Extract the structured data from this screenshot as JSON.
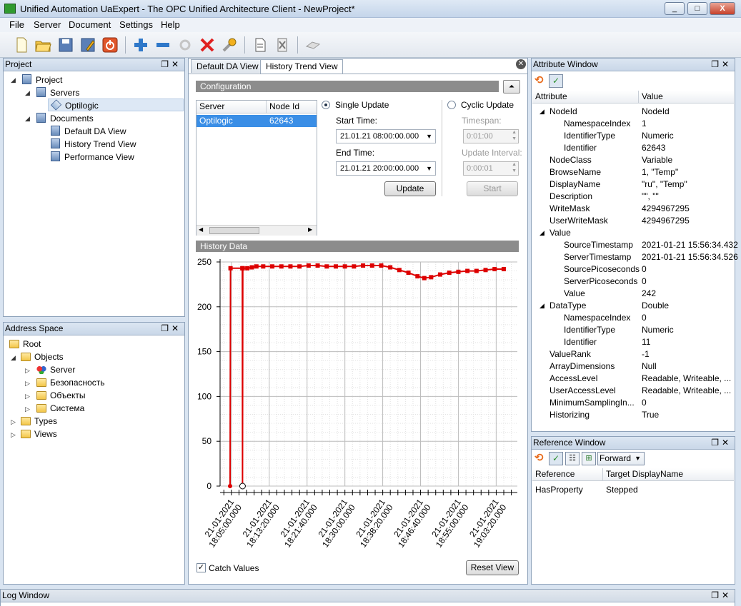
{
  "window": {
    "title": "Unified Automation UaExpert - The OPC Unified Architecture Client - NewProject*",
    "controls": [
      "_",
      "□",
      "X"
    ]
  },
  "menu": [
    {
      "label": "File"
    },
    {
      "label": "Server"
    },
    {
      "label": "Document"
    },
    {
      "label": "Settings"
    },
    {
      "label": "Help"
    }
  ],
  "toolbar": {
    "icons": [
      "new-document-icon",
      "open-folder-icon",
      "save-icon",
      "save-as-icon",
      "exit-icon",
      "add-server-icon",
      "remove-server-icon",
      "connect-icon",
      "disconnect-icon",
      "settings-wrench-icon",
      "new-document-view-icon",
      "close-document-icon",
      "eraser-icon"
    ]
  },
  "project_panel": {
    "title": "Project",
    "tree": {
      "root": "Project",
      "servers": "Servers",
      "server_item": "Optilogic",
      "documents": "Documents",
      "docs": [
        "Default DA View",
        "History Trend View",
        "Performance View"
      ]
    }
  },
  "address_panel": {
    "title": "Address Space",
    "tree": {
      "root": "Root",
      "objects": "Objects",
      "children": [
        "Server",
        "Безопасность",
        "Объекты",
        "Система"
      ],
      "types": "Types",
      "views": "Views"
    }
  },
  "center": {
    "tabs": [
      "Default DA View",
      "History Trend View"
    ],
    "active_tab": "History Trend View",
    "configuration_label": "Configuration",
    "server_table": {
      "headers": [
        "Server",
        "Node Id"
      ],
      "rows": [
        [
          "Optilogic",
          "62643"
        ]
      ]
    },
    "single_update_label": "Single Update",
    "start_time_label": "Start Time:",
    "start_time_value": "21.01.21 08:00:00.000",
    "end_time_label": "End Time:",
    "end_time_value": "21.01.21 20:00:00.000",
    "update_button": "Update",
    "cyclic_update_label": "Cyclic Update",
    "timespan_label": "Timespan:",
    "timespan_value": "0:01:00",
    "update_interval_label": "Update Interval:",
    "update_interval_value": "0:00:01",
    "start_button": "Start",
    "history_data_label": "History Data",
    "catch_values_label": "Catch Values",
    "reset_view_button": "Reset View"
  },
  "chart_data": {
    "type": "line",
    "title": "",
    "xlabel": "",
    "ylabel": "",
    "ylim": [
      0,
      250
    ],
    "yticks": [
      0,
      50,
      100,
      150,
      200,
      250
    ],
    "xtick_labels": [
      "21-01-2021 18:05:00.000",
      "21-01-2021 18:13:20.000",
      "21-01-2021 18:21:40.000",
      "21-01-2021 18:30:00.000",
      "21-01-2021 18:38:20.000",
      "21-01-2021 18:46:40.000",
      "21-01-2021 18:55:00.000",
      "21-01-2021 19:03:20.000"
    ],
    "xlim_minutes_from_first_tick": [
      -2.5,
      63
    ],
    "grid": true,
    "series": [
      {
        "color": "#dd0000",
        "points_min_value": [
          [
            -0.3,
            0
          ],
          [
            -0.2,
            243
          ],
          [
            2.4,
            243
          ],
          [
            2.45,
            0
          ],
          [
            2.5,
            243
          ],
          [
            3.5,
            243
          ],
          [
            4.5,
            244
          ],
          [
            5.5,
            245
          ],
          [
            7,
            245
          ],
          [
            9,
            245
          ],
          [
            11,
            245
          ],
          [
            13,
            245
          ],
          [
            15,
            245
          ],
          [
            17,
            246
          ],
          [
            19,
            246
          ],
          [
            21,
            245
          ],
          [
            23,
            245
          ],
          [
            25,
            245
          ],
          [
            27,
            245
          ],
          [
            29,
            246
          ],
          [
            31,
            246
          ],
          [
            33,
            246
          ],
          [
            35,
            244
          ],
          [
            37,
            241
          ],
          [
            39,
            238
          ],
          [
            41,
            234
          ],
          [
            42.5,
            232
          ],
          [
            44,
            233
          ],
          [
            46,
            236
          ],
          [
            48,
            238
          ],
          [
            50,
            239
          ],
          [
            52,
            240
          ],
          [
            54,
            240
          ],
          [
            56,
            241
          ],
          [
            58,
            242
          ],
          [
            60,
            242
          ]
        ]
      }
    ]
  },
  "attribute_panel": {
    "title": "Attribute Window",
    "headers": [
      "Attribute",
      "Value"
    ],
    "rows": [
      {
        "indent": 1,
        "expander": true,
        "name": "NodeId",
        "value": "NodeId"
      },
      {
        "indent": 2,
        "name": "NamespaceIndex",
        "value": "1"
      },
      {
        "indent": 2,
        "name": "IdentifierType",
        "value": "Numeric"
      },
      {
        "indent": 2,
        "name": "Identifier",
        "value": "62643"
      },
      {
        "indent": 1,
        "name": "NodeClass",
        "value": "Variable"
      },
      {
        "indent": 1,
        "name": "BrowseName",
        "value": "1, \"Temp\""
      },
      {
        "indent": 1,
        "name": "DisplayName",
        "value": "\"ru\", \"Temp\""
      },
      {
        "indent": 1,
        "name": "Description",
        "value": "\"\", \"\""
      },
      {
        "indent": 1,
        "name": "WriteMask",
        "value": "4294967295"
      },
      {
        "indent": 1,
        "name": "UserWriteMask",
        "value": "4294967295"
      },
      {
        "indent": 1,
        "expander": true,
        "name": "Value",
        "value": ""
      },
      {
        "indent": 2,
        "name": "SourceTimestamp",
        "value": "2021-01-21 15:56:34.432"
      },
      {
        "indent": 2,
        "name": "ServerTimestamp",
        "value": "2021-01-21 15:56:34.526"
      },
      {
        "indent": 2,
        "name": "SourcePicoseconds",
        "value": "0"
      },
      {
        "indent": 2,
        "name": "ServerPicoseconds",
        "value": "0"
      },
      {
        "indent": 2,
        "name": "Value",
        "value": "242"
      },
      {
        "indent": 1,
        "expander": true,
        "name": "DataType",
        "value": "Double"
      },
      {
        "indent": 2,
        "name": "NamespaceIndex",
        "value": "0"
      },
      {
        "indent": 2,
        "name": "IdentifierType",
        "value": "Numeric"
      },
      {
        "indent": 2,
        "name": "Identifier",
        "value": "11"
      },
      {
        "indent": 1,
        "name": "ValueRank",
        "value": "-1"
      },
      {
        "indent": 1,
        "name": "ArrayDimensions",
        "value": "Null"
      },
      {
        "indent": 1,
        "name": "AccessLevel",
        "value": "Readable, Writeable, ..."
      },
      {
        "indent": 1,
        "name": "UserAccessLevel",
        "value": "Readable, Writeable, ..."
      },
      {
        "indent": 1,
        "name": "MinimumSamplingIn...",
        "value": "0"
      },
      {
        "indent": 1,
        "name": "Historizing",
        "value": "True"
      }
    ]
  },
  "reference_panel": {
    "title": "Reference Window",
    "direction": "Forward",
    "headers": [
      "Reference",
      "Target DisplayName"
    ],
    "rows": [
      [
        "HasProperty",
        "Stepped"
      ]
    ]
  },
  "log_panel": {
    "title": "Log Window"
  }
}
